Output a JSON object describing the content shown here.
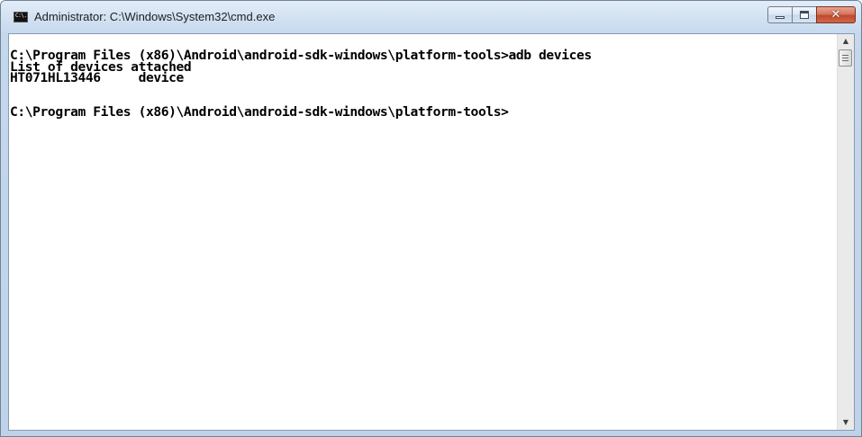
{
  "window": {
    "title": "Administrator: C:\\Windows\\System32\\cmd.exe",
    "icon": "cmd-icon",
    "icon_text": "C:\\."
  },
  "caption_buttons": {
    "minimize_icon": "minimize-icon",
    "maximize_icon": "maximize-icon",
    "close_icon": "close-icon",
    "close_glyph": "✕"
  },
  "console": {
    "lines": [
      "C:\\Program Files (x86)\\Android\\android-sdk-windows\\platform-tools>adb devices",
      "List of devices attached",
      "HT071HL13446     device",
      "",
      "",
      "C:\\Program Files (x86)\\Android\\android-sdk-windows\\platform-tools>"
    ]
  },
  "scrollbar": {
    "up_arrow": "▲",
    "down_arrow": "▼"
  },
  "colors": {
    "console_background": "#ffffff",
    "console_text": "#000000",
    "close_button": "#c14a2d"
  }
}
